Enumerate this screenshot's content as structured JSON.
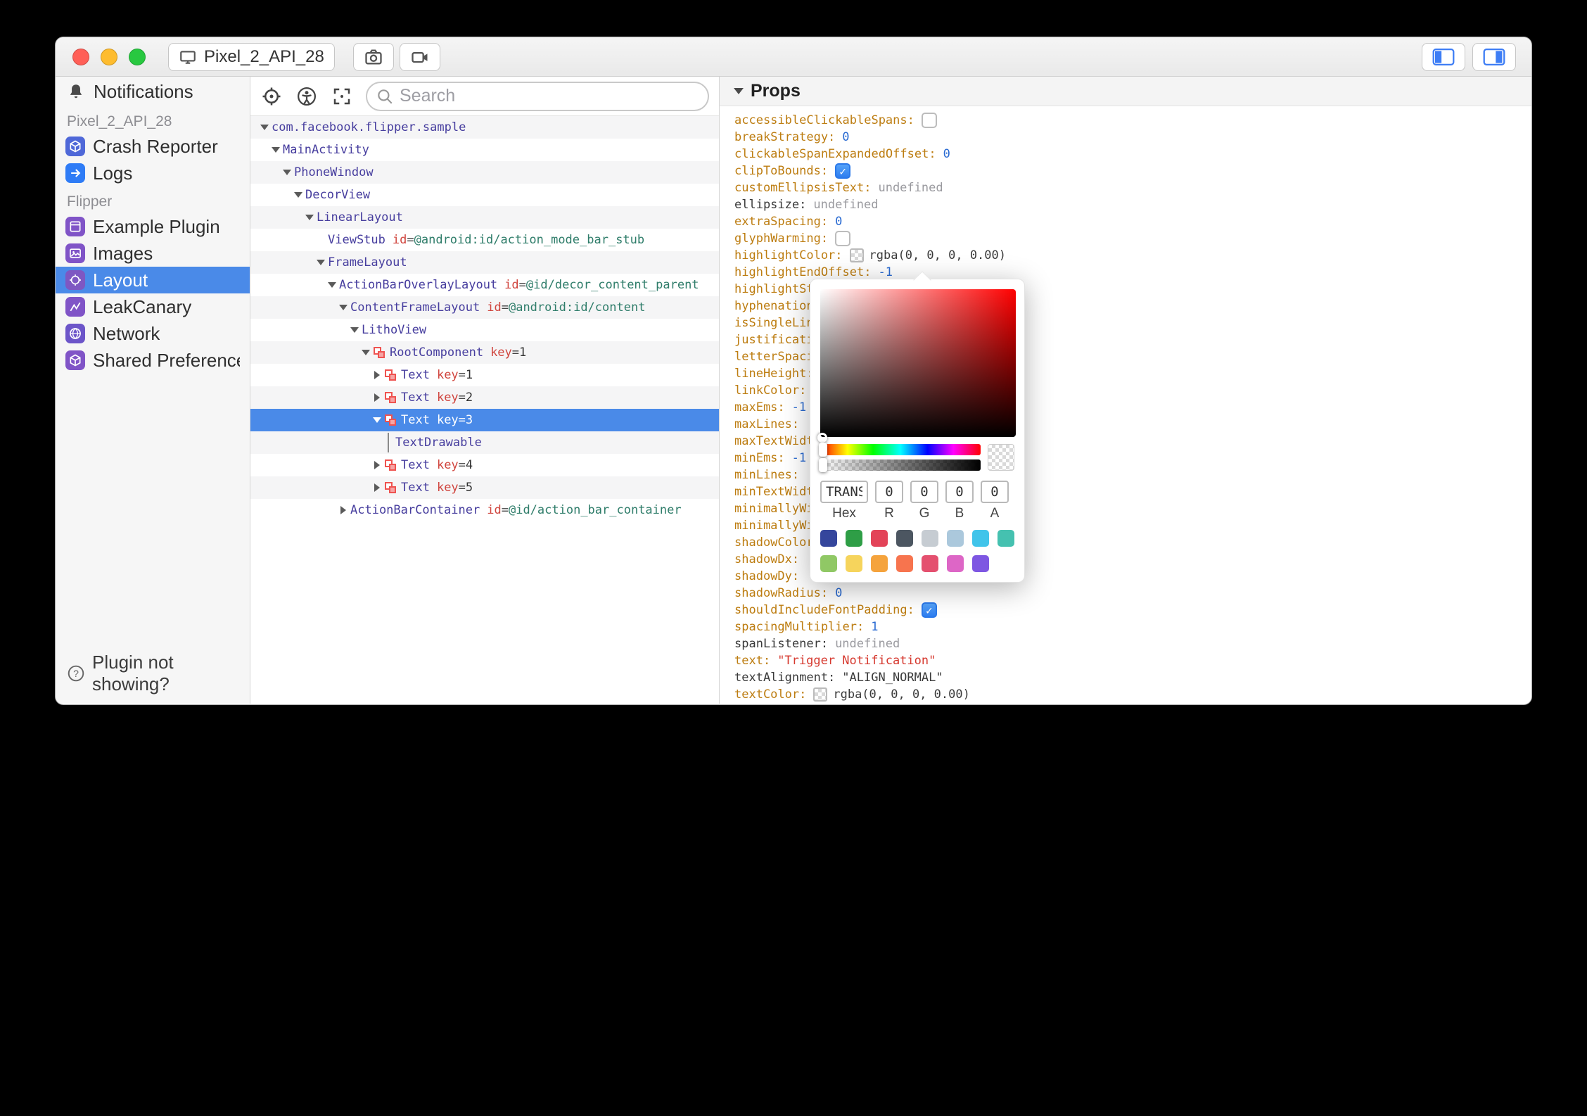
{
  "titlebar": {
    "device": "Pixel_2_API_28"
  },
  "sidebar": {
    "header": "Notifications",
    "sections": [
      {
        "label": "Pixel_2_API_28",
        "items": [
          {
            "label": "Crash Reporter",
            "icon": "crash-reporter",
            "color": "#4f68d8"
          },
          {
            "label": "Logs",
            "icon": "logs",
            "color": "#2f7cf6"
          }
        ]
      },
      {
        "label": "Flipper",
        "items": [
          {
            "label": "Example Plugin",
            "icon": "example-plugin",
            "color": "#8054c7"
          },
          {
            "label": "Images",
            "icon": "images",
            "color": "#8054c7"
          },
          {
            "label": "Layout",
            "icon": "layout",
            "color": "#7e57c2",
            "selected": true
          },
          {
            "label": "LeakCanary",
            "icon": "leakcanary",
            "color": "#8054c7"
          },
          {
            "label": "Network",
            "icon": "network",
            "color": "#6c55c9"
          },
          {
            "label": "Shared Preferences Viewer",
            "icon": "shared-preferences",
            "color": "#8054c7"
          }
        ]
      }
    ],
    "footer": "Plugin not showing?"
  },
  "toolbar": {
    "search_placeholder": "Search"
  },
  "tree": {
    "nodes": [
      {
        "depth": 0,
        "chevron": "down",
        "name": "com.facebook.flipper.sample"
      },
      {
        "depth": 1,
        "chevron": "down",
        "name": "MainActivity"
      },
      {
        "depth": 2,
        "chevron": "down",
        "name": "PhoneWindow"
      },
      {
        "depth": 3,
        "chevron": "down",
        "name": "DecorView"
      },
      {
        "depth": 4,
        "chevron": "down",
        "name": "LinearLayout"
      },
      {
        "depth": 5,
        "chevron": null,
        "name": "ViewStub",
        "attrs": [
          {
            "k": "id",
            "v": "@android:id/action_mode_bar_stub",
            "kind": "path"
          }
        ]
      },
      {
        "depth": 5,
        "chevron": "down",
        "name": "FrameLayout"
      },
      {
        "depth": 6,
        "chevron": "down",
        "name": "ActionBarOverlayLayout",
        "attrs": [
          {
            "k": "id",
            "v": "@id/decor_content_parent",
            "kind": "path"
          }
        ]
      },
      {
        "depth": 7,
        "chevron": "down",
        "name": "ContentFrameLayout",
        "attrs": [
          {
            "k": "id",
            "v": "@android:id/content",
            "kind": "path"
          }
        ]
      },
      {
        "depth": 8,
        "chevron": "down",
        "name": "LithoView"
      },
      {
        "depth": 9,
        "chevron": "down",
        "icon": "litho",
        "name": "RootComponent",
        "attrs": [
          {
            "k": "key",
            "v": "1",
            "kind": "num"
          }
        ]
      },
      {
        "depth": 10,
        "chevron": "right",
        "icon": "litho",
        "name": "Text",
        "attrs": [
          {
            "k": "key",
            "v": "1",
            "kind": "num"
          }
        ]
      },
      {
        "depth": 10,
        "chevron": "right",
        "icon": "litho",
        "name": "Text",
        "attrs": [
          {
            "k": "key",
            "v": "2",
            "kind": "num"
          }
        ]
      },
      {
        "depth": 10,
        "chevron": "down",
        "icon": "litho",
        "name": "Text",
        "attrs": [
          {
            "k": "key",
            "v": "3",
            "kind": "num"
          }
        ],
        "selected": true
      },
      {
        "depth": 11,
        "chevron": "guide",
        "name": "TextDrawable"
      },
      {
        "depth": 10,
        "chevron": "right",
        "icon": "litho",
        "name": "Text",
        "attrs": [
          {
            "k": "key",
            "v": "4",
            "kind": "num"
          }
        ]
      },
      {
        "depth": 10,
        "chevron": "right",
        "icon": "litho",
        "name": "Text",
        "attrs": [
          {
            "k": "key",
            "v": "5",
            "kind": "num"
          }
        ]
      },
      {
        "depth": 7,
        "chevron": "right",
        "name": "ActionBarContainer",
        "attrs": [
          {
            "k": "id",
            "v": "@id/action_bar_container",
            "kind": "path"
          }
        ]
      }
    ]
  },
  "props": {
    "title": "Props",
    "rows": [
      {
        "key": "accessibleClickableSpans",
        "type": "checkbox",
        "checked": false
      },
      {
        "key": "breakStrategy",
        "type": "number",
        "value": "0"
      },
      {
        "key": "clickableSpanExpandedOffset",
        "type": "number",
        "value": "0"
      },
      {
        "key": "clipToBounds",
        "type": "checkbox",
        "checked": true
      },
      {
        "key": "customEllipsisText",
        "type": "undefined"
      },
      {
        "key": "ellipsize",
        "type": "undefined",
        "dark_key": true
      },
      {
        "key": "extraSpacing",
        "type": "number",
        "value": "0"
      },
      {
        "key": "glyphWarming",
        "type": "checkbox",
        "checked": false
      },
      {
        "key": "highlightColor",
        "type": "color",
        "value": "rgba(0, 0, 0, 0.00)"
      },
      {
        "key": "highlightEndOffset",
        "type": "number",
        "value": "-1"
      },
      {
        "key": "highlightStartOffset",
        "type": "none"
      },
      {
        "key": "hyphenationFrequency",
        "type": "none"
      },
      {
        "key": "isSingleLine",
        "type": "none"
      },
      {
        "key": "justificationMode",
        "type": "none"
      },
      {
        "key": "letterSpacing",
        "type": "none"
      },
      {
        "key": "lineHeight",
        "type": "none"
      },
      {
        "key": "linkColor",
        "type": "none"
      },
      {
        "key": "maxEms",
        "type": "number",
        "value": "-1"
      },
      {
        "key": "maxLines",
        "type": "none"
      },
      {
        "key": "maxTextWidth",
        "type": "none"
      },
      {
        "key": "minEms",
        "type": "number",
        "value": "-1"
      },
      {
        "key": "minLines",
        "type": "none"
      },
      {
        "key": "minTextWidth",
        "type": "none"
      },
      {
        "key": "minimallyWide",
        "type": "none"
      },
      {
        "key": "minimallyWideThreshold",
        "type": "none"
      },
      {
        "key": "shadowColor",
        "type": "none"
      },
      {
        "key": "shadowDx",
        "type": "none"
      },
      {
        "key": "shadowDy",
        "type": "none"
      },
      {
        "key": "shadowRadius",
        "type": "number",
        "value": "0"
      },
      {
        "key": "shouldIncludeFontPadding",
        "type": "checkbox",
        "checked": true
      },
      {
        "key": "spacingMultiplier",
        "type": "number",
        "value": "1"
      },
      {
        "key": "spanListener",
        "type": "undefined",
        "dark_key": true
      },
      {
        "key": "text",
        "type": "string",
        "value": "Trigger Notification"
      },
      {
        "key": "textAlignment",
        "type": "enum",
        "value": "ALIGN_NORMAL",
        "dark_key": true
      },
      {
        "key": "textColor",
        "type": "color",
        "value": "rgba(0, 0, 0, 0.00)"
      }
    ]
  },
  "color_picker": {
    "hex_value": "TRANS",
    "hex_label": "Hex",
    "r_value": "0",
    "g_value": "0",
    "b_value": "0",
    "a_value": "0",
    "r_label": "R",
    "g_label": "G",
    "b_label": "B",
    "a_label": "A",
    "swatch_rows": [
      [
        "#35469c",
        "#2e9e46",
        "#e34358",
        "#4c5661",
        "#c6ccd2",
        "#abc8dc",
        "#41c4ea",
        "#45c1b0"
      ],
      [
        "#90c865",
        "#f6d45c",
        "#f5a33c",
        "#f7744e",
        "#e4506f",
        "#dd66c6",
        "#7e57e2"
      ]
    ]
  }
}
